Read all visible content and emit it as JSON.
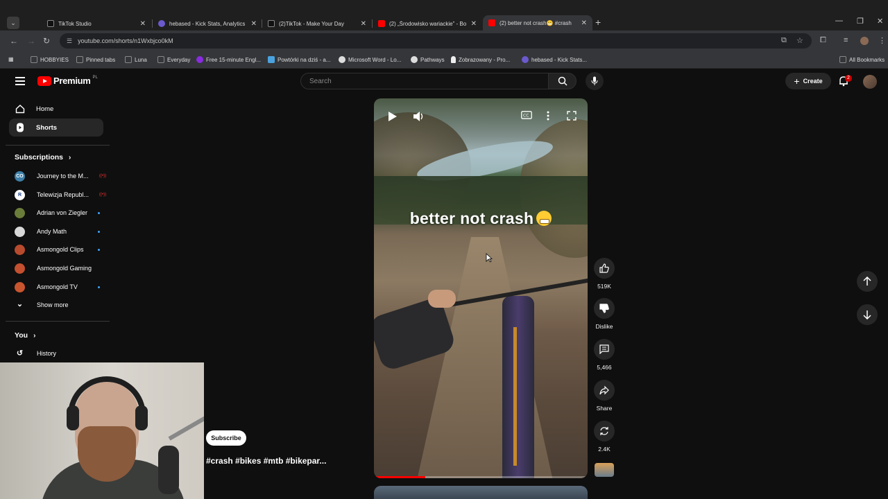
{
  "browser": {
    "tabs": [
      {
        "title": "TikTok Studio",
        "color": "#111111"
      },
      {
        "title": "hebased - Kick Stats, Analytics",
        "color": "#6a5acd"
      },
      {
        "title": "(2)TikTok - Make Your Day",
        "color": "#111111"
      },
      {
        "title": "(2) „Środowisko wariackie” - Bo",
        "color": "#ff0000"
      },
      {
        "title": "(2) better not crash😬 #crash",
        "color": "#ff0000"
      }
    ],
    "active_tab_index": 4,
    "url": "youtube.com/shorts/n1Wxbjco0kM",
    "bookmarks": [
      {
        "label": "HOBBYIES",
        "icon": "folder-icon"
      },
      {
        "label": "Pinned tabs",
        "icon": "folder-icon"
      },
      {
        "label": "Luna",
        "icon": "folder-icon"
      },
      {
        "label": "Everyday",
        "icon": "folder-icon"
      },
      {
        "label": "Free 15-minute Engl...",
        "icon": "ef-icon"
      },
      {
        "label": "Powtórki na dziś - a...",
        "icon": "anki-icon"
      },
      {
        "label": "Microsoft Word - Lo...",
        "icon": "globe-icon"
      },
      {
        "label": "Pathways",
        "icon": "globe-icon"
      },
      {
        "label": "Zobrazowany - Pro...",
        "icon": "bulb-icon"
      },
      {
        "label": "hebased - Kick Stats...",
        "icon": "kick-icon"
      }
    ],
    "all_bookmarks": "All Bookmarks"
  },
  "header": {
    "logo_text": "Premium",
    "country_code": "PL",
    "search_placeholder": "Search",
    "create_label": "Create",
    "notifications_count": "2"
  },
  "sidebar": {
    "home": "Home",
    "shorts": "Shorts",
    "subscriptions_title": "Subscriptions",
    "subscriptions": [
      {
        "name": "Journey to the M...",
        "status": "live",
        "avatar": "#3d7fa8",
        "initials": "CO"
      },
      {
        "name": "Telewizja Republ...",
        "status": "live",
        "avatar": "#1c3f8c",
        "initials": "R"
      },
      {
        "name": "Adrian von Ziegler",
        "status": "new",
        "avatar": "#6b7d3a",
        "initials": ""
      },
      {
        "name": "Andy Math",
        "status": "new",
        "avatar": "#d8d8d8",
        "initials": ""
      },
      {
        "name": "Asmongold Clips",
        "status": "new",
        "avatar": "#b84a2e",
        "initials": ""
      },
      {
        "name": "Asmongold Gaming",
        "status": "",
        "avatar": "#c4502f",
        "initials": ""
      },
      {
        "name": "Asmongold TV",
        "status": "new",
        "avatar": "#c9552f",
        "initials": ""
      }
    ],
    "show_more": "Show more",
    "you_title": "You",
    "history": "History"
  },
  "short": {
    "caption": "better not crash",
    "title": "#crash #bikes #mtb #bikepar...",
    "subscribe_label": "Subscribe",
    "progress": 0.24
  },
  "actions": {
    "likes": "519K",
    "dislike": "Dislike",
    "comments": "5,466",
    "share": "Share",
    "remix": "2.4K"
  }
}
